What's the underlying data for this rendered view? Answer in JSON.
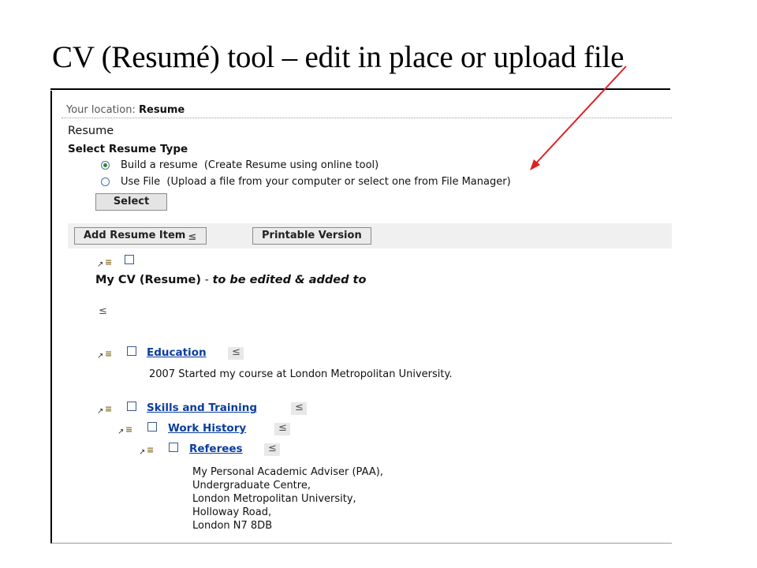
{
  "slide": {
    "title": "CV (Resumé) tool – edit in place or upload file"
  },
  "colors": {
    "arrow": "#e02020",
    "link": "#0a3d9e",
    "radio_selected": "#2a8a2a"
  },
  "screen": {
    "location_label": "Your location:",
    "location_value": "Resume",
    "page_heading": "Resume",
    "select_type_heading": "Select Resume Type",
    "options": [
      {
        "label": "Build a resume  (Create Resume using online tool)",
        "selected": true
      },
      {
        "label": "Use File  (Upload a file from your computer or select one from File Manager)",
        "selected": false
      }
    ],
    "select_button": "Select",
    "toolbar": {
      "add_item": "Add Resume Item",
      "printable": "Printable Version"
    },
    "cv_title": "My CV (Resume)",
    "cv_separator": " - ",
    "cv_note": "to be edited & added to",
    "items": [
      {
        "label": "Education",
        "detail": "2007 Started my course at London Metropolitan University."
      },
      {
        "label": "Skills and Training"
      },
      {
        "label": "Work History"
      },
      {
        "label": "Referees",
        "address": [
          "My Personal Academic Adviser (PAA),",
          "Undergraduate Centre,",
          "London Metropolitan University,",
          "Holloway Road,",
          "London N7 8DB"
        ]
      }
    ]
  }
}
